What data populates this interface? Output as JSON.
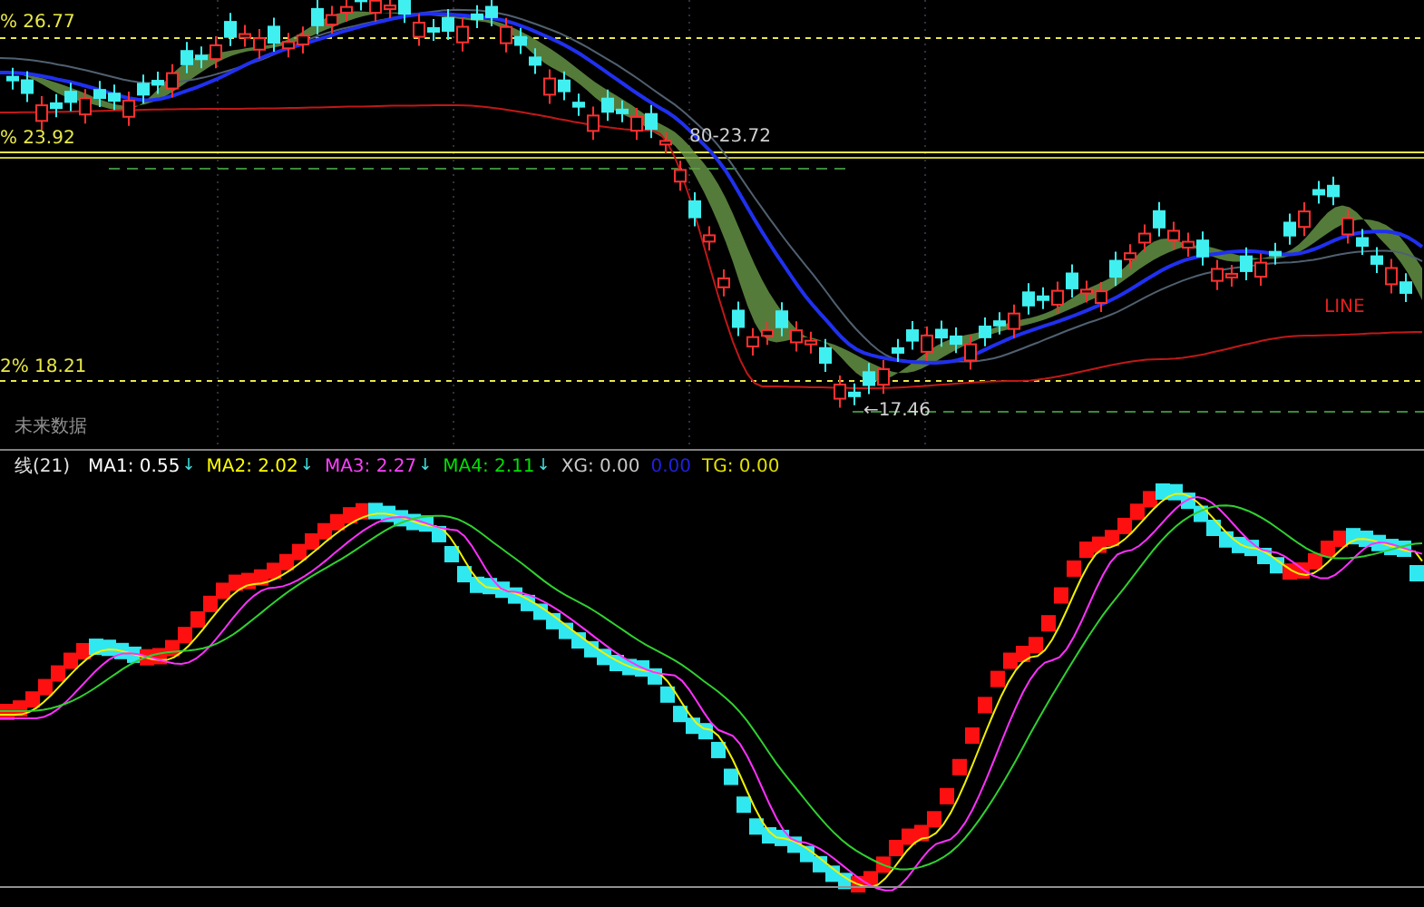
{
  "price_panel": {
    "levels": [
      {
        "text": "% 26.77"
      },
      {
        "text": "% 23.92"
      },
      {
        "text": "2% 18.21"
      }
    ],
    "markers": [
      {
        "text": "80-23.72"
      },
      {
        "text": "←17.46"
      },
      {
        "text": "LINE"
      }
    ],
    "note": "未来数据"
  },
  "indicator_header": {
    "title": "线(21)",
    "values": [
      {
        "label": "MA1: 0.55",
        "arrow": "↓",
        "color": "#ffffff"
      },
      {
        "label": "MA2: 2.02",
        "arrow": "↓",
        "color": "#ffff00"
      },
      {
        "label": "MA3: 2.27",
        "arrow": "↓",
        "color": "#ff40ff"
      },
      {
        "label": "MA4: 2.11",
        "arrow": "↓",
        "color": "#00e000"
      },
      {
        "label": "XG: 0.00",
        "color": "#c8c8c8"
      },
      {
        "label": "0.00",
        "color": "#2020e0"
      },
      {
        "label": "TG: 0.00",
        "color": "#e0e000"
      }
    ]
  }
}
